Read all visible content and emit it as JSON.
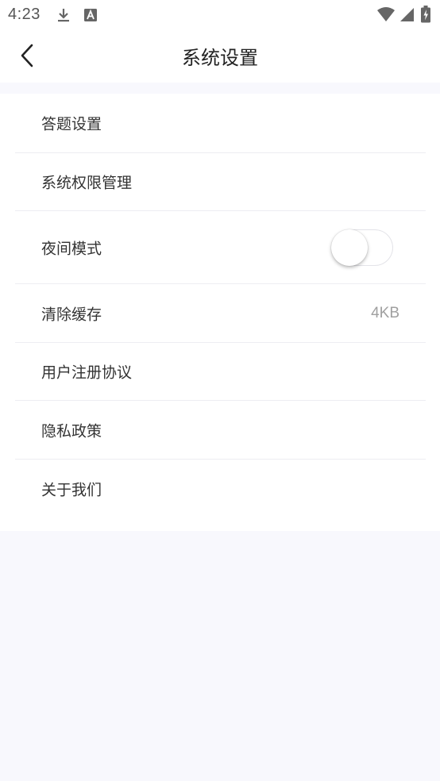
{
  "status_bar": {
    "time": "4:23",
    "icons": [
      "download-icon",
      "text-a-icon",
      "wifi-icon",
      "signal-icon",
      "battery-charging-icon"
    ]
  },
  "header": {
    "title": "系统设置",
    "back_icon": "chevron-left-icon"
  },
  "settings": {
    "items": [
      {
        "label": "答题设置"
      },
      {
        "label": "系统权限管理"
      },
      {
        "label": "夜间模式",
        "toggle": false
      },
      {
        "label": "清除缓存",
        "value": "4KB"
      },
      {
        "label": "用户注册协议"
      },
      {
        "label": "隐私政策"
      },
      {
        "label": "关于我们"
      }
    ]
  },
  "colors": {
    "page_background": "#f8f8fd",
    "card_background": "#ffffff",
    "divider": "#ededf2",
    "secondary_text": "#a0a0a0"
  }
}
